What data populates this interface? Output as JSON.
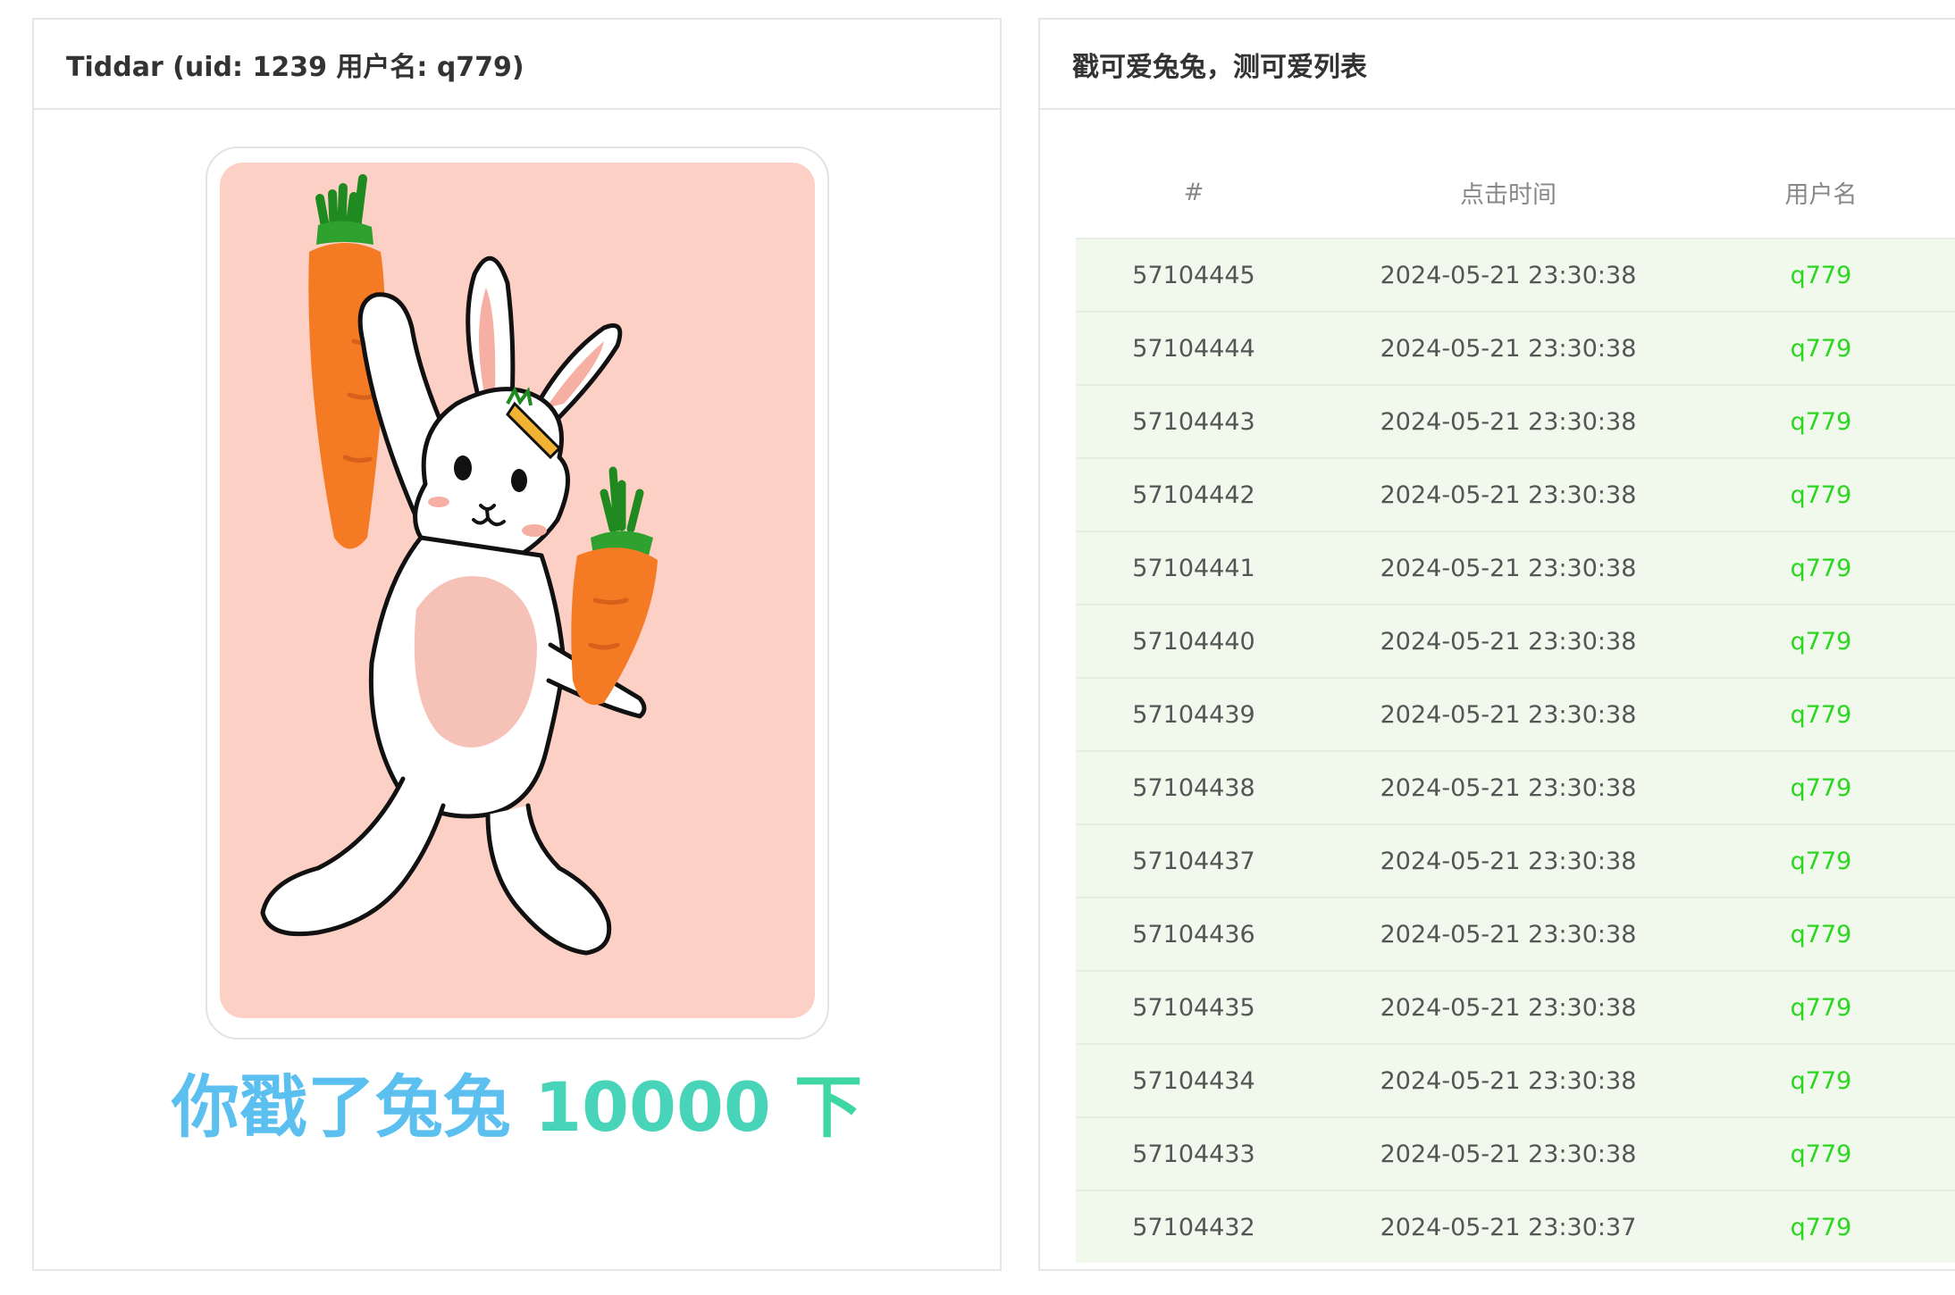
{
  "left_panel": {
    "title": "Tiddar (uid: 1239 用户名: q779)"
  },
  "counter": {
    "prefix": "你戳了兔兔",
    "count": "10000",
    "suffix": "下"
  },
  "colors": {
    "card_background": "#fdd0c6",
    "username_green": "#2ad61f",
    "row_background": "#f1f8ec",
    "counter_gradient_start": "#5bc0f0",
    "counter_gradient_end": "#3dd6a4"
  },
  "right_panel": {
    "title": "戳可爱兔兔，测可爱列表",
    "columns": [
      "#",
      "点击时间",
      "用户名"
    ],
    "rows": [
      {
        "id": "57104445",
        "time": "2024-05-21 23:30:38",
        "user": "q779"
      },
      {
        "id": "57104444",
        "time": "2024-05-21 23:30:38",
        "user": "q779"
      },
      {
        "id": "57104443",
        "time": "2024-05-21 23:30:38",
        "user": "q779"
      },
      {
        "id": "57104442",
        "time": "2024-05-21 23:30:38",
        "user": "q779"
      },
      {
        "id": "57104441",
        "time": "2024-05-21 23:30:38",
        "user": "q779"
      },
      {
        "id": "57104440",
        "time": "2024-05-21 23:30:38",
        "user": "q779"
      },
      {
        "id": "57104439",
        "time": "2024-05-21 23:30:38",
        "user": "q779"
      },
      {
        "id": "57104438",
        "time": "2024-05-21 23:30:38",
        "user": "q779"
      },
      {
        "id": "57104437",
        "time": "2024-05-21 23:30:38",
        "user": "q779"
      },
      {
        "id": "57104436",
        "time": "2024-05-21 23:30:38",
        "user": "q779"
      },
      {
        "id": "57104435",
        "time": "2024-05-21 23:30:38",
        "user": "q779"
      },
      {
        "id": "57104434",
        "time": "2024-05-21 23:30:38",
        "user": "q779"
      },
      {
        "id": "57104433",
        "time": "2024-05-21 23:30:38",
        "user": "q779"
      },
      {
        "id": "57104432",
        "time": "2024-05-21 23:30:37",
        "user": "q779"
      }
    ]
  }
}
